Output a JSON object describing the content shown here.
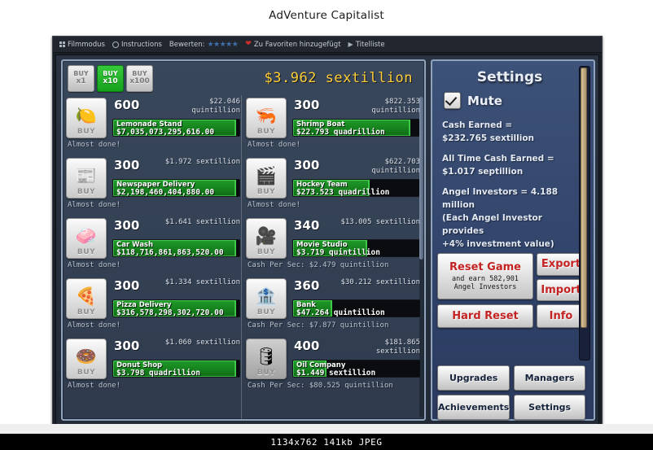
{
  "page": {
    "title": "AdVenture Capitalist"
  },
  "toolbar": {
    "cinema_label": "Filmmodus",
    "instructions_label": "Instructions",
    "rate_label": "Bewerten:",
    "stars": "★★★★★",
    "favorite_label": "Zu Favoriten hinzugefügt",
    "playlist_label": "Titelliste"
  },
  "game": {
    "cash": "$3.962 sextillion",
    "multipliers": [
      {
        "top": "BUY",
        "bottom": "x1",
        "active": false,
        "name": "buy-x1"
      },
      {
        "top": "BUY",
        "bottom": "x10",
        "active": true,
        "name": "buy-x10"
      },
      {
        "top": "BUY",
        "bottom": "x100",
        "active": false,
        "name": "buy-x100"
      }
    ],
    "buy_label": "BUY",
    "businesses_left": [
      {
        "icon": "🍋",
        "qty": "600",
        "cost": "$22.046\nquintillion",
        "name": "Lemonade Stand",
        "amount": "$7,035,073,295,616.00",
        "status": "Almost done!",
        "fill": 97,
        "dim": false
      },
      {
        "icon": "📰",
        "qty": "300",
        "cost": "$1.972 sextillion",
        "name": "Newspaper Delivery",
        "amount": "$2,198,460,404,880.00",
        "status": "Almost done!",
        "fill": 97,
        "dim": false
      },
      {
        "icon": "🧼",
        "qty": "300",
        "cost": "$1.641 sextillion",
        "name": "Car Wash",
        "amount": "$118,716,861,863,520.00",
        "status": "Almost done!",
        "fill": 97,
        "dim": false
      },
      {
        "icon": "🍕",
        "qty": "300",
        "cost": "$1.334 sextillion",
        "name": "Pizza Delivery",
        "amount": "$316,578,298,302,720.00",
        "status": "Almost done!",
        "fill": 97,
        "dim": false
      },
      {
        "icon": "🍩",
        "qty": "300",
        "cost": "$1.060 sextillion",
        "name": "Donut Shop",
        "amount": "$3.798 quadrillion",
        "status": "Almost done!",
        "fill": 97,
        "dim": false
      }
    ],
    "businesses_right": [
      {
        "icon": "🦐",
        "qty": "300",
        "cost": "$822.353\nquintillion",
        "name": "Shrimp Boat",
        "amount": "$22.793 quadrillion",
        "status": "Almost done!",
        "fill": 92,
        "dim": false
      },
      {
        "icon": "🎬",
        "qty": "300",
        "cost": "$622.703\nquintillion",
        "name": "Hockey Team",
        "amount": "$273.523 quadrillion",
        "status": "Almost done!",
        "fill": 60,
        "dim": false
      },
      {
        "icon": "🎥",
        "qty": "340",
        "cost": "$13.005 sextillion",
        "name": "Movie Studio",
        "amount": "$3.719 quintillion",
        "status": "Cash Per Sec: $2.479 quintillion",
        "fill": 58,
        "dim": false
      },
      {
        "icon": "🏦",
        "qty": "360",
        "cost": "$30.212 sextillion",
        "name": "Bank",
        "amount": "$47.264 quintillion",
        "status": "Cash Per Sec: $7.877 quintillion",
        "fill": 30,
        "dim": false
      },
      {
        "icon": "🛢",
        "qty": "400",
        "cost": "$181.865\nsextillion",
        "name": "Oil Company",
        "amount": "$1.449 sextillion",
        "status": "Cash Per Sec: $80.525 quintillion",
        "fill": 26,
        "dim": true
      }
    ]
  },
  "settings": {
    "title": "Settings",
    "mute_label": "Mute",
    "mute_checked": true,
    "cash_earned_label": "Cash Earned =",
    "cash_earned_value": "$232.765 sextillion",
    "all_time_label": "All Time Cash Earned =",
    "all_time_value": "$1.017 septillion",
    "angel_line1": "Angel Investors = 4.188 million",
    "angel_line2": "(Each Angel Investor provides",
    "angel_line3": "+4% investment value)",
    "reset_game_label": "Reset Game",
    "reset_game_sub": "and earn 582,901\nAngel Investors",
    "export_label": "Export",
    "import_label": "Import",
    "hard_reset_label": "Hard Reset",
    "info_label": "Info",
    "nav": [
      {
        "label": "Upgrades",
        "name": "nav-upgrades"
      },
      {
        "label": "Managers",
        "name": "nav-managers"
      },
      {
        "label": "Achievements",
        "name": "nav-achievements"
      },
      {
        "label": "Settings",
        "name": "nav-settings"
      }
    ]
  },
  "footer": {
    "info": "1134x762  141kb  JPEG"
  }
}
